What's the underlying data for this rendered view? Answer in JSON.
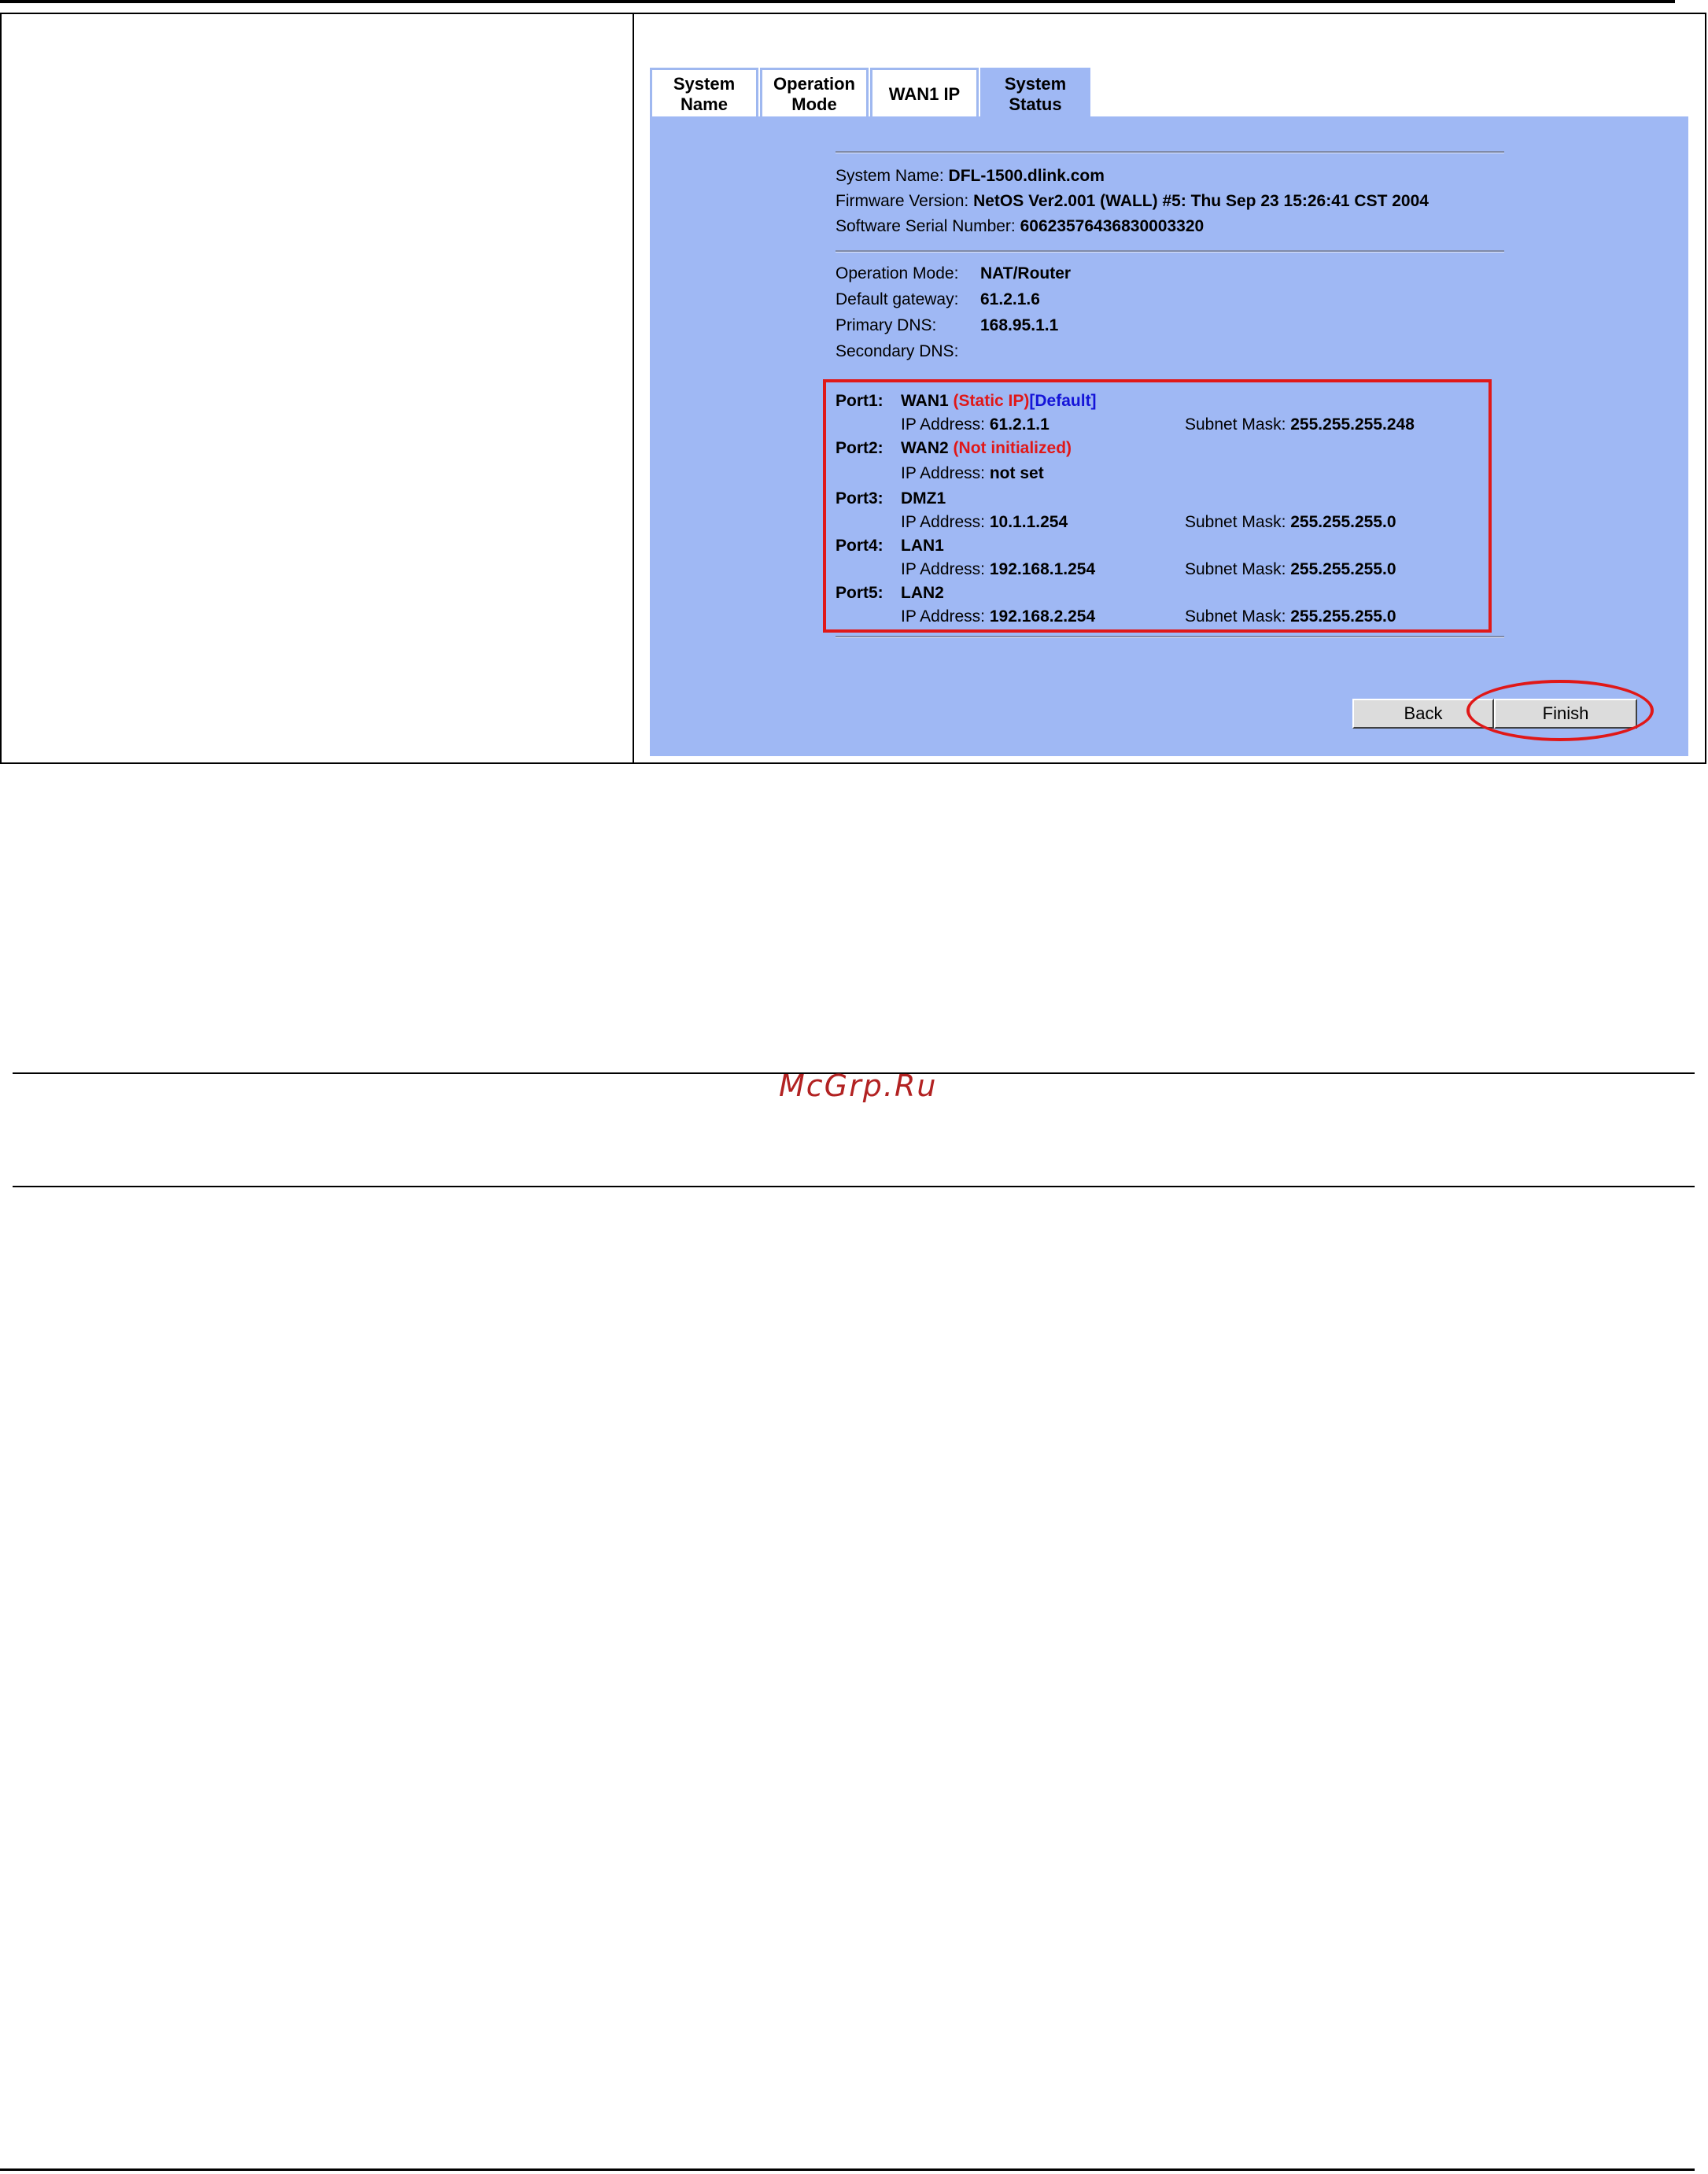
{
  "tabs": [
    {
      "label": "System\nName",
      "active": false
    },
    {
      "label": "Operation\nMode",
      "active": false
    },
    {
      "label": "WAN1 IP",
      "active": false
    },
    {
      "label": "System\nStatus",
      "active": true
    }
  ],
  "system": {
    "name_label": "System Name:",
    "name_value": "DFL-1500.dlink.com",
    "firmware_label": "Firmware Version:",
    "firmware_value": "NetOS Ver2.001 (WALL) #5: Thu Sep 23 15:26:41 CST 2004",
    "serial_label": "Software Serial Number:",
    "serial_value": "60623576436830003320"
  },
  "mode": {
    "operation_label": "Operation Mode:",
    "operation_value": "NAT/Router",
    "gateway_label": "Default gateway:",
    "gateway_value": "61.2.1.6",
    "primary_dns_label": "Primary DNS:",
    "primary_dns_value": "168.95.1.1",
    "secondary_dns_label": "Secondary DNS:",
    "secondary_dns_value": ""
  },
  "ports": {
    "ip_label": "IP Address:",
    "mask_label": "Subnet Mask:",
    "items": [
      {
        "label": "Port1:",
        "name": "WAN1",
        "tag_red": "(Static IP)",
        "tag_blue": "[Default]",
        "ip": "61.2.1.1",
        "mask": "255.255.255.248"
      },
      {
        "label": "Port2:",
        "name": "WAN2",
        "tag_red": "(Not initialized)",
        "tag_blue": "",
        "ip": "not set",
        "mask": ""
      },
      {
        "label": "Port3:",
        "name": "DMZ1",
        "tag_red": "",
        "tag_blue": "",
        "ip": "10.1.1.254",
        "mask": "255.255.255.0"
      },
      {
        "label": "Port4:",
        "name": "LAN1",
        "tag_red": "",
        "tag_blue": "",
        "ip": "192.168.1.254",
        "mask": "255.255.255.0"
      },
      {
        "label": "Port5:",
        "name": "LAN2",
        "tag_red": "",
        "tag_blue": "",
        "ip": "192.168.2.254",
        "mask": "255.255.255.0"
      }
    ]
  },
  "buttons": {
    "back": "Back",
    "finish": "Finish"
  },
  "watermark": "McGrp.Ru",
  "colors": {
    "panel_bg": "#9fb8f4",
    "highlight_red": "#e01818",
    "default_blue": "#1414d8"
  }
}
